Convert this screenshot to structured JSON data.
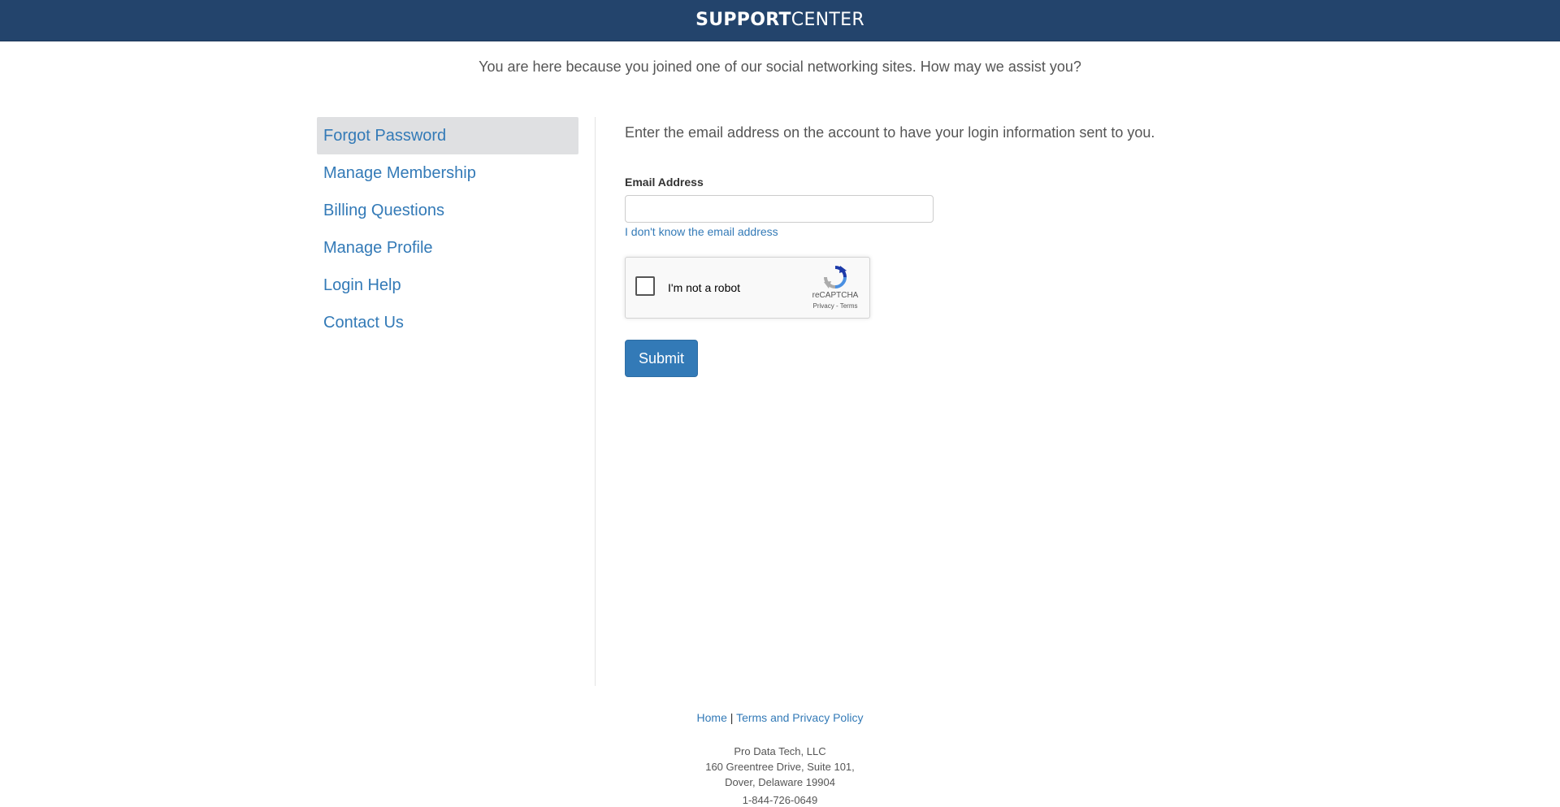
{
  "header": {
    "logo_bold": "SUPPORT",
    "logo_light": "CENTER",
    "background_color": "#23446c"
  },
  "tagline": "You are here because you joined one of our social networking sites. How may we assist you?",
  "sidebar": {
    "items": [
      {
        "label": "Forgot Password",
        "active": true
      },
      {
        "label": "Manage Membership",
        "active": false
      },
      {
        "label": "Billing Questions",
        "active": false
      },
      {
        "label": "Manage Profile",
        "active": false
      },
      {
        "label": "Login Help",
        "active": false
      },
      {
        "label": "Contact Us",
        "active": false
      }
    ]
  },
  "main": {
    "instructions": "Enter the email address on the account to have your login information sent to you.",
    "email_label": "Email Address",
    "email_value": "",
    "email_placeholder": "",
    "forgot_email_link": "I don't know the email address",
    "recaptcha": {
      "label": "I'm not a robot",
      "brand": "reCAPTCHA",
      "privacy": "Privacy",
      "separator": " - ",
      "terms": "Terms",
      "checked": false,
      "icon": "recaptcha-logo-icon"
    },
    "submit_label": "Submit",
    "accent_color": "#337ab7"
  },
  "footer": {
    "home_link": "Home",
    "separator": "|",
    "terms_link": "Terms and Privacy Policy",
    "company": "Pro Data Tech, LLC",
    "address_line1": "160 Greentree Drive, Suite 101,",
    "address_line2": "Dover, Delaware 19904",
    "phone": "1-844-726-0649"
  }
}
